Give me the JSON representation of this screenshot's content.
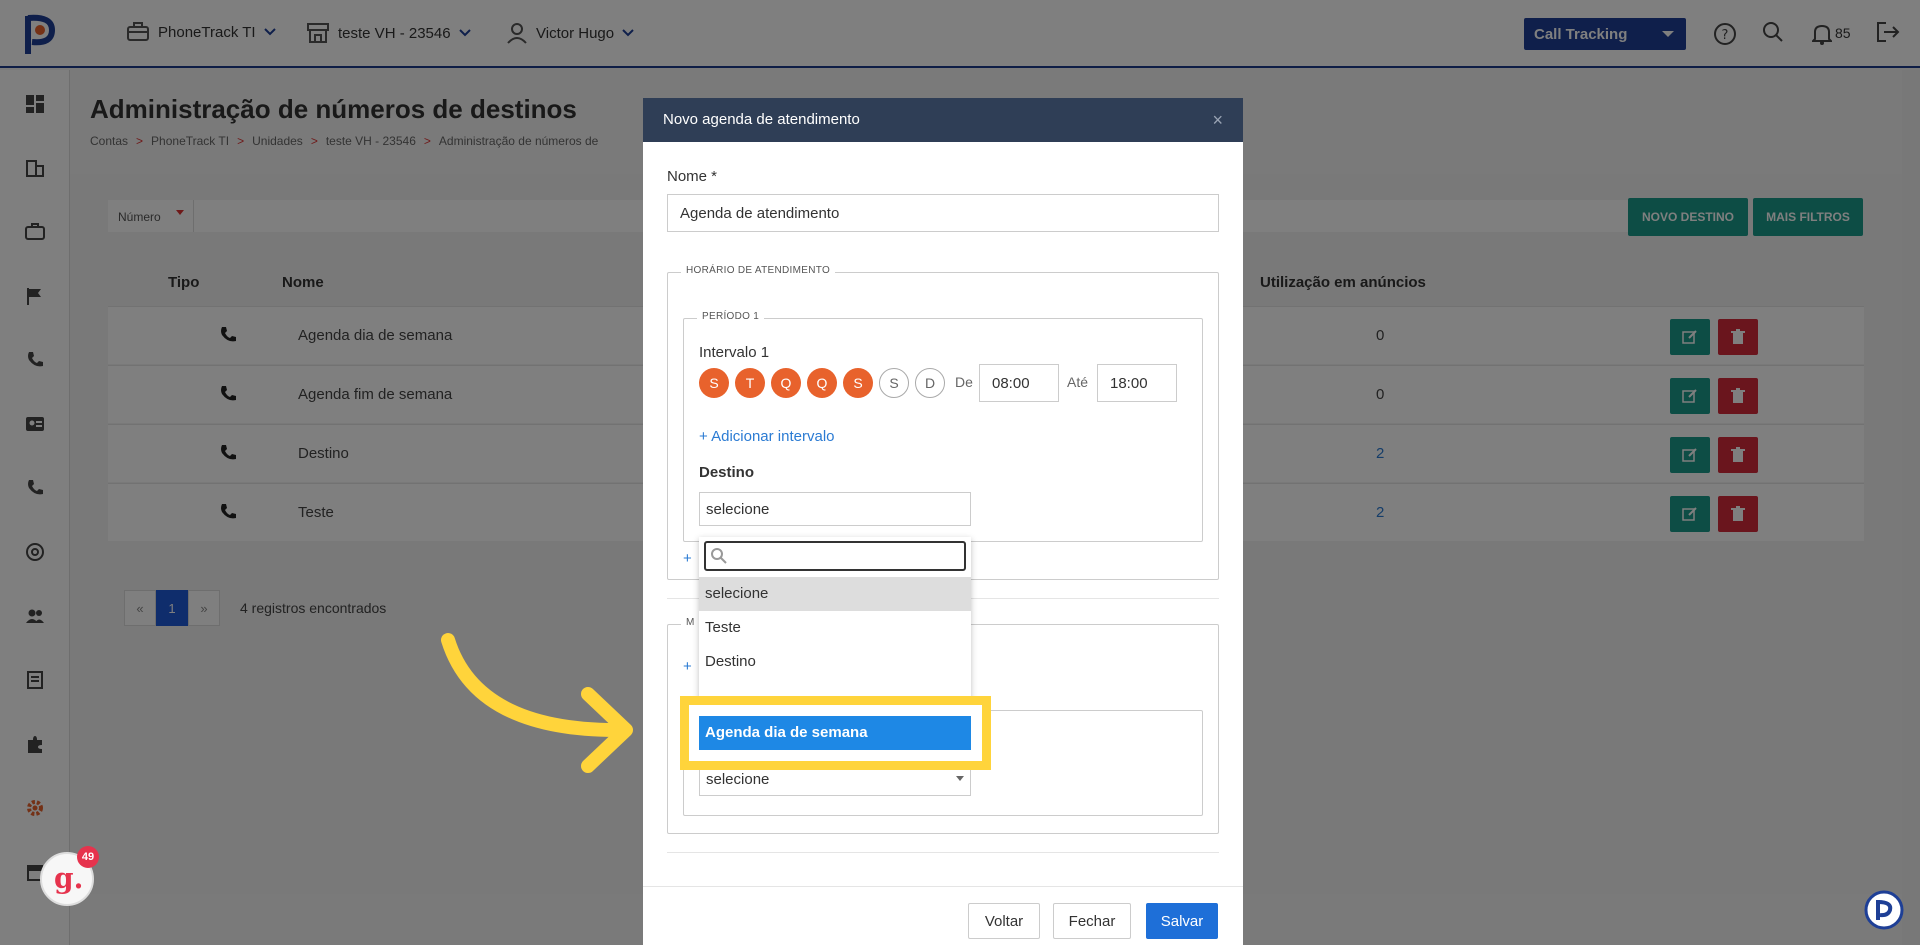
{
  "header": {
    "account": "PhoneTrack TI",
    "unit": "teste VH - 23546",
    "user": "Victor Hugo",
    "product_select": "Call Tracking",
    "notifications_count": "85"
  },
  "page": {
    "title": "Administração de números de destinos",
    "breadcrumb": [
      "Contas",
      "PhoneTrack TI",
      "Unidades",
      "teste VH - 23546",
      "Administração de números de"
    ],
    "breadcrumb_sep": ">",
    "filter_label": "Número",
    "btn_new": "NOVO DESTINO",
    "btn_filters": "MAIS FILTROS",
    "columns": {
      "tipo": "Tipo",
      "nome": "Nome",
      "uso": "Utilização em anúncios"
    },
    "rows": [
      {
        "name": "Agenda dia de semana",
        "usage": "0"
      },
      {
        "name": "Agenda fim de semana",
        "usage": "0"
      },
      {
        "name": "Destino",
        "usage": "2"
      },
      {
        "name": "Teste",
        "usage": "2"
      }
    ],
    "pager": {
      "prev": "«",
      "current": "1",
      "next": "»"
    },
    "records": "4 registros encontrados"
  },
  "modal": {
    "title": "Novo agenda de atendimento",
    "close": "×",
    "name_label": "Nome *",
    "name_value": "Agenda de atendimento",
    "legend_horario": "HORÁRIO DE ATENDIMENTO",
    "legend_periodo": "PERÍODO 1",
    "interval_label": "Intervalo 1",
    "days": [
      "S",
      "T",
      "Q",
      "Q",
      "S",
      "S",
      "D"
    ],
    "from_label": "De",
    "from_value": "08:00",
    "to_label": "Até",
    "to_value": "18:00",
    "add_interval": "+ Adicionar intervalo",
    "destino_label": "Destino",
    "destino_value": "selecione",
    "second_destino_value": "selecione",
    "plus": "+",
    "legend_m": "M",
    "btn_back": "Voltar",
    "btn_close": "Fechar",
    "btn_save": "Salvar"
  },
  "dropdown": {
    "options": [
      "selecione",
      "Teste",
      "Destino"
    ],
    "highlighted": "Agenda dia de semana"
  },
  "widget": {
    "count": "49",
    "letter": "g."
  },
  "colors": {
    "primary": "#1e3f96",
    "accent_orange": "#e8622c",
    "action_green": "#1a9a8a",
    "action_red": "#d42a3a",
    "highlight_yellow": "#ffd43b",
    "option_blue": "#1e88e5"
  }
}
